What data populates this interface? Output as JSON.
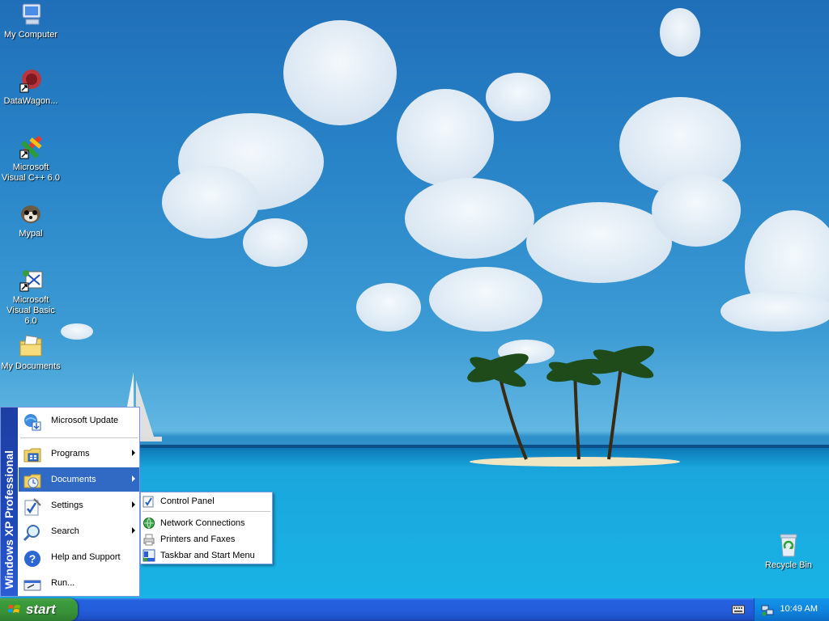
{
  "desktop": {
    "icons": [
      {
        "label": "My Computer",
        "icon": "my-computer-icon"
      },
      {
        "label": "DataWagon...",
        "icon": "datawagon-icon"
      },
      {
        "label": "Microsoft Visual C++ 6.0",
        "icon": "visual-cpp-icon"
      },
      {
        "label": "Mypal",
        "icon": "mypal-icon"
      },
      {
        "label": "Microsoft Visual Basic 6.0",
        "icon": "visual-basic-icon"
      },
      {
        "label": "My Documents",
        "icon": "my-documents-icon"
      },
      {
        "label": "Recycle Bin",
        "icon": "recycle-bin-icon"
      }
    ]
  },
  "start_menu": {
    "side_text": "Windows XP Professional",
    "items": [
      {
        "label": "Microsoft Update",
        "icon": "microsoft-update-icon",
        "submenu": false
      },
      {
        "label": "Programs",
        "icon": "programs-icon",
        "submenu": true
      },
      {
        "label": "Documents",
        "icon": "documents-icon",
        "submenu": true
      },
      {
        "label": "Settings",
        "icon": "settings-icon",
        "submenu": true
      },
      {
        "label": "Search",
        "icon": "search-icon",
        "submenu": true
      },
      {
        "label": "Help and Support",
        "icon": "help-icon",
        "submenu": false
      },
      {
        "label": "Run...",
        "icon": "run-icon",
        "submenu": false
      }
    ],
    "active_item": "Documents"
  },
  "settings_submenu": {
    "items": [
      {
        "label": "Control Panel",
        "icon": "control-panel-icon"
      },
      {
        "label": "Network Connections",
        "icon": "network-connections-icon"
      },
      {
        "label": "Printers and Faxes",
        "icon": "printers-faxes-icon"
      },
      {
        "label": "Taskbar and Start Menu",
        "icon": "taskbar-start-menu-icon"
      }
    ]
  },
  "taskbar": {
    "start_label": "start",
    "clock": "10:49 AM"
  },
  "colors": {
    "taskbar_blue": "#245edc",
    "start_green": "#389238",
    "menu_highlight": "#316ac5",
    "start_side_blue": "#1f48b8"
  }
}
